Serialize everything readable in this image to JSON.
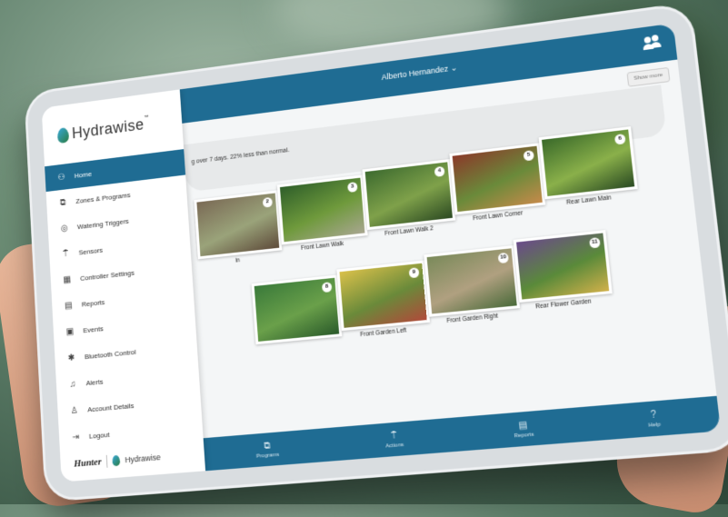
{
  "header": {
    "user_name": "Alberto Hernandez",
    "user_chevron": "⌄",
    "show_more": "Show more"
  },
  "info": {
    "text": "g over 7 days. 22% less than normal."
  },
  "logo": {
    "text": "Hydrawise",
    "trademark": "™"
  },
  "sidebar": {
    "items": [
      {
        "label": "Home",
        "icon": "home-people-icon",
        "glyph": "⚇",
        "active": true
      },
      {
        "label": "Zones & Programs",
        "icon": "zones-icon",
        "glyph": "⧉"
      },
      {
        "label": "Watering Triggers",
        "icon": "triggers-icon",
        "glyph": "◎"
      },
      {
        "label": "Sensors",
        "icon": "sensor-icon",
        "glyph": "⍑"
      },
      {
        "label": "Controller Settings",
        "icon": "controller-icon",
        "glyph": "▦"
      },
      {
        "label": "Reports",
        "icon": "reports-icon",
        "glyph": "▤"
      },
      {
        "label": "Events",
        "icon": "events-icon",
        "glyph": "▣"
      },
      {
        "label": "Bluetooth Control",
        "icon": "bluetooth-icon",
        "glyph": "✱"
      },
      {
        "label": "Alerts",
        "icon": "bell-icon",
        "glyph": "♫"
      },
      {
        "label": "Account Details",
        "icon": "person-icon",
        "glyph": "♙"
      },
      {
        "label": "Logout",
        "icon": "logout-icon",
        "glyph": "⇥"
      }
    ],
    "footer_brand": "Hunter",
    "footer_product": "Hydrawise"
  },
  "zones": [
    {
      "label": "in",
      "number": "2",
      "colors": [
        "#7a6a55",
        "#9aa37a",
        "#5e4b3a"
      ]
    },
    {
      "label": "Front Lawn Walk",
      "number": "3",
      "colors": [
        "#2f5f2a",
        "#6f9a3c",
        "#a8a690"
      ]
    },
    {
      "label": "Front Lawn Walk 2",
      "number": "4",
      "colors": [
        "#3d6b2f",
        "#7fa14a",
        "#2c4a22"
      ]
    },
    {
      "label": "Front Lawn Corner",
      "number": "5",
      "colors": [
        "#8a3a2a",
        "#6a8a3a",
        "#c58a4a"
      ]
    },
    {
      "label": "Rear Lawn Main",
      "number": "6",
      "colors": [
        "#3a6a2a",
        "#8ab04a",
        "#2a4a22"
      ]
    },
    {
      "label": "",
      "number": "8",
      "colors": [
        "#3a7a3a",
        "#6aa04a",
        "#2a5a2a"
      ]
    },
    {
      "label": "Front Garden Left",
      "number": "9",
      "colors": [
        "#d9c04a",
        "#6a8a3a",
        "#b04a3a"
      ]
    },
    {
      "label": "Front Garden Right",
      "number": "10",
      "colors": [
        "#7a8a5a",
        "#b0a080",
        "#4a6a3a"
      ]
    },
    {
      "label": "Rear Flower Garden",
      "number": "11",
      "colors": [
        "#6a4a8a",
        "#5a8a3a",
        "#d0b04a"
      ]
    }
  ],
  "bottombar": [
    {
      "label": "Programs",
      "icon": "programs-icon",
      "glyph": "⧉"
    },
    {
      "label": "Actions",
      "icon": "actions-icon",
      "glyph": "⍑"
    },
    {
      "label": "Reports",
      "icon": "reports-icon",
      "glyph": "▤"
    },
    {
      "label": "Help",
      "icon": "help-icon",
      "glyph": "?"
    }
  ],
  "colors": {
    "brand_blue": "#1f6c93"
  }
}
